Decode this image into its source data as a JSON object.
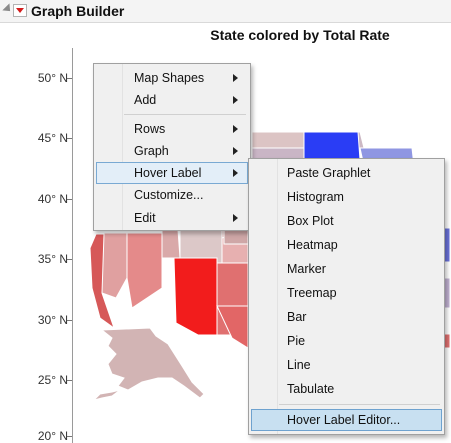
{
  "window": {
    "title": "Graph Builder",
    "collapse_icon": "disclosure-triangle-icon",
    "menu_icon": "red-triangle-menu-icon"
  },
  "plot": {
    "title": "State colored by Total Rate",
    "y_ticks": [
      "50° N",
      "45° N",
      "40° N",
      "35° N",
      "30° N",
      "25° N",
      "20° N"
    ],
    "color_scale": {
      "high": "#f21c1c",
      "mid": "#d9bfbf",
      "low": "#2a3df5"
    }
  },
  "context_menu": {
    "items": [
      {
        "label": "Map Shapes",
        "submenu": true
      },
      {
        "label": "Add",
        "submenu": true
      },
      {
        "label": "Rows",
        "submenu": true
      },
      {
        "label": "Graph",
        "submenu": true
      },
      {
        "label": "Hover Label",
        "submenu": true,
        "highlighted": true
      },
      {
        "label": "Customize...",
        "submenu": false
      },
      {
        "label": "Edit",
        "submenu": true
      }
    ]
  },
  "hover_label_submenu": {
    "items": [
      {
        "label": "Paste Graphlet"
      },
      {
        "label": "Histogram"
      },
      {
        "label": "Box Plot"
      },
      {
        "label": "Heatmap"
      },
      {
        "label": "Marker"
      },
      {
        "label": "Treemap"
      },
      {
        "label": "Bar"
      },
      {
        "label": "Pie"
      },
      {
        "label": "Line"
      },
      {
        "label": "Tabulate"
      },
      {
        "label": "Hover Label Editor...",
        "highlighted": true
      }
    ]
  }
}
